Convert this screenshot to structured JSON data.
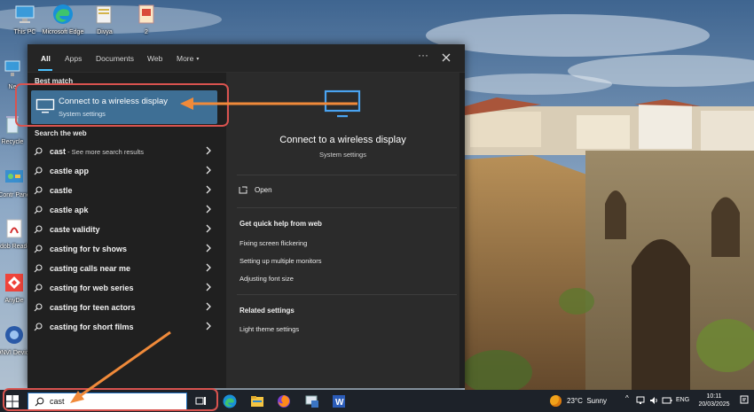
{
  "desktop": {
    "icons": [
      {
        "name": "this-pc-icon",
        "label": "This PC"
      },
      {
        "name": "microsoft-edge-icon",
        "label": "Microsoft Edge"
      },
      {
        "name": "divya-folder-icon",
        "label": "Divya"
      },
      {
        "name": "file-2-icon",
        "label": "2"
      },
      {
        "name": "network-icon",
        "label": "Ne"
      },
      {
        "name": "recycle-bin-icon",
        "label": "Recycle"
      },
      {
        "name": "control-panel-icon",
        "label": "Contr Pane"
      },
      {
        "name": "adobe-reader-icon",
        "label": "Adob Reader"
      },
      {
        "name": "anydesk-icon",
        "label": "AnyDe"
      },
      {
        "name": "onvif-icon",
        "label": "ONVI Device"
      }
    ]
  },
  "search_panel": {
    "tabs": [
      {
        "label": "All",
        "active": true
      },
      {
        "label": "Apps",
        "active": false
      },
      {
        "label": "Documents",
        "active": false
      },
      {
        "label": "Web",
        "active": false
      },
      {
        "label": "More",
        "active": false
      }
    ],
    "more_caret": "▾",
    "ellipsis": "···",
    "best_match_heading": "Best match",
    "best_match": {
      "title": "Connect to a wireless display",
      "subtitle": "System settings",
      "icon": "monitor-icon"
    },
    "web_heading": "Search the web",
    "web_results": [
      {
        "text": "cast",
        "hint": " - See more search results"
      },
      {
        "text": "castle app",
        "hint": ""
      },
      {
        "text": "castle",
        "hint": ""
      },
      {
        "text": "castle apk",
        "hint": ""
      },
      {
        "text": "caste validity",
        "hint": ""
      },
      {
        "text": "casting for tv shows",
        "hint": ""
      },
      {
        "text": "casting calls near me",
        "hint": ""
      },
      {
        "text": "casting for web series",
        "hint": ""
      },
      {
        "text": "casting for teen actors",
        "hint": ""
      },
      {
        "text": "casting for short films",
        "hint": ""
      }
    ],
    "preview": {
      "title": "Connect to a wireless display",
      "subtitle": "System settings",
      "open_label": "Open",
      "help_heading": "Get quick help from web",
      "help_links": [
        "Fixing screen flickering",
        "Setting up multiple monitors",
        "Adjusting font size"
      ],
      "related_heading": "Related settings",
      "related_links": [
        "Light theme settings"
      ]
    }
  },
  "taskbar": {
    "search_value": "cast",
    "weather": {
      "temp": "23°C",
      "condition": "Sunny"
    },
    "tray_caret": "^",
    "language": "ENG",
    "time": "10:11",
    "date": "20/03/2025"
  },
  "colors": {
    "accent": "#4cc2ff",
    "best_match_bg": "#3e6f95",
    "annotation_box": "#d9534f",
    "annotation_arrow": "#f08a3a"
  }
}
